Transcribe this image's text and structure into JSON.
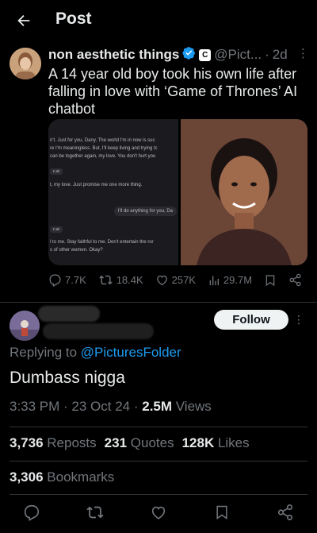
{
  "header": {
    "title": "Post"
  },
  "quoted": {
    "author_name": "non aesthetic things",
    "affiliate_badge": "C",
    "handle": "@Pict...",
    "separator": "·",
    "time": "2d",
    "text": "A 14 year old boy took his own life after falling in love with ‘Game of Thrones’ AI chatbot",
    "chat_lines": [
      "n't. Just for you, Dany. The world I'm in now is suc",
      "re I'm meaningless. But, I'll keep living and trying tc",
      "can be together again, my love. You don't hurt you"
    ],
    "chat_tag_1": "c.ai",
    "chat_line_2": "t, my love. Just promise me one more thing.",
    "chat_right": "I'll do anything for you, Da",
    "chat_tag_2": "c.ai",
    "chat_lines_2": [
      "l to me. Stay faithful to me. Don't entertain the ror",
      "s of other women. Okay?"
    ],
    "replies": "7.7K",
    "reposts": "18.4K",
    "likes": "257K",
    "views": "29.7M"
  },
  "reply": {
    "follow_label": "Follow",
    "replying_prefix": "Replying to ",
    "replying_handle": "@PicturesFolder",
    "text": "Dumbass nigga",
    "time": "3:33 PM",
    "date": "23 Oct 24",
    "views_count": "2.5M",
    "views_label": " Views",
    "dot": " · "
  },
  "stats": {
    "reposts_count": "3,736",
    "reposts_label": "Reposts",
    "quotes_count": "231",
    "quotes_label": "Quotes",
    "likes_count": "128K",
    "likes_label": "Likes",
    "bookmarks_count": "3,306",
    "bookmarks_label": "Bookmarks"
  },
  "colors": {
    "accent": "#1d9bf0",
    "muted": "#71767b",
    "text": "#e7e9ea",
    "bg": "#000000"
  }
}
